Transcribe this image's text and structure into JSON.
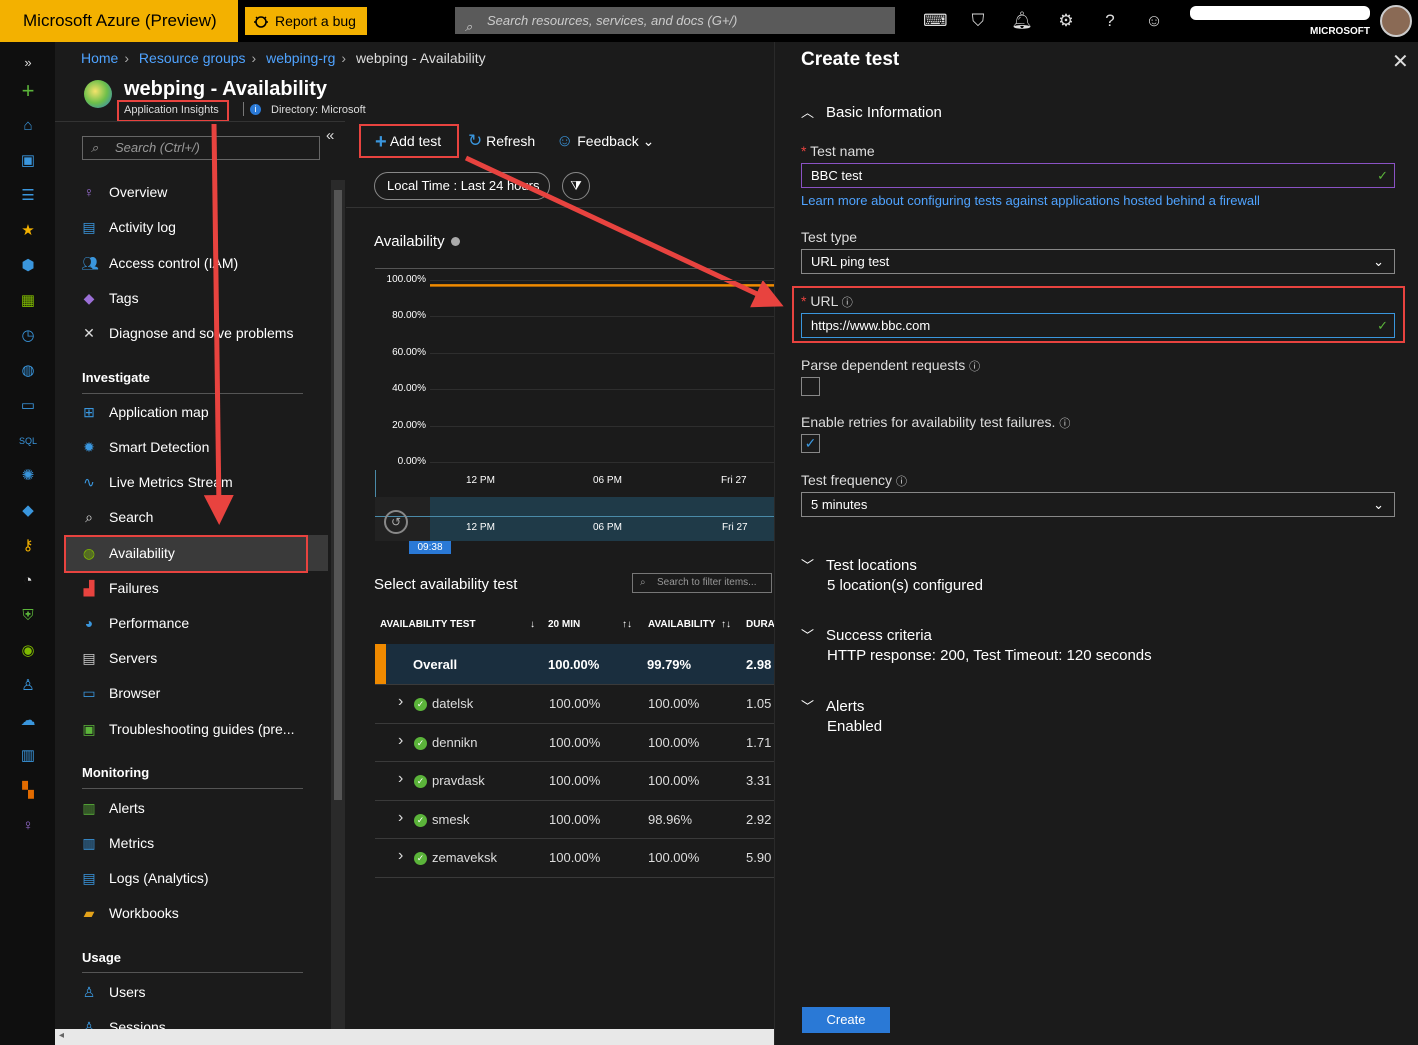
{
  "topbar": {
    "brand": "Microsoft Azure (Preview)",
    "bug_button": "Report a bug",
    "search_placeholder": "Search resources, services, and docs (G+/)",
    "tenant": "MICROSOFT"
  },
  "breadcrumb": {
    "home": "Home",
    "resource_groups": "Resource groups",
    "rg": "webping-rg",
    "current": "webping - Availability"
  },
  "header": {
    "title": "webping - Availability",
    "subtitle": "Application Insights",
    "directory": "Directory: Microsoft"
  },
  "leftnav": {
    "search_placeholder": "Search (Ctrl+/)",
    "items_top": [
      "Overview",
      "Activity log",
      "Access control (IAM)",
      "Tags",
      "Diagnose and solve problems"
    ],
    "investigate_label": "Investigate",
    "investigate": [
      "Application map",
      "Smart Detection",
      "Live Metrics Stream",
      "Search",
      "Availability",
      "Failures",
      "Performance",
      "Servers",
      "Browser",
      "Troubleshooting guides (pre..."
    ],
    "monitoring_label": "Monitoring",
    "monitoring": [
      "Alerts",
      "Metrics",
      "Logs (Analytics)",
      "Workbooks"
    ],
    "usage_label": "Usage",
    "usage": [
      "Users",
      "Sessions"
    ]
  },
  "toolbar": {
    "add_test": "Add test",
    "refresh": "Refresh",
    "feedback": "Feedback"
  },
  "time_range": "Local Time : Last 24 hours",
  "chart_data": {
    "type": "line",
    "title": "Availability",
    "y_ticks": [
      "100.00%",
      "80.00%",
      "60.00%",
      "40.00%",
      "20.00%",
      "0.00%"
    ],
    "x_ticks": [
      "12 PM",
      "06 PM",
      "Fri 27"
    ],
    "ylim": [
      0,
      100
    ],
    "series": [
      {
        "color": "#f08a00",
        "values": [
          99.79,
          99.79,
          99.79,
          99.79,
          99.79,
          99.79
        ]
      }
    ],
    "brush_time": "09:38"
  },
  "table": {
    "title": "Select availability test",
    "filter_placeholder": "Search to filter items...",
    "headers": [
      "AVAILABILITY TEST",
      "20 MIN",
      "AVAILABILITY",
      "DURA"
    ],
    "overall": {
      "name": "Overall",
      "min20": "100.00%",
      "availability": "99.79%",
      "duration": "2.98"
    },
    "rows": [
      {
        "name": "datelsk",
        "min20": "100.00%",
        "availability": "100.00%",
        "duration": "1.05"
      },
      {
        "name": "dennikn",
        "min20": "100.00%",
        "availability": "100.00%",
        "duration": "1.71"
      },
      {
        "name": "pravdask",
        "min20": "100.00%",
        "availability": "100.00%",
        "duration": "3.31"
      },
      {
        "name": "smesk",
        "min20": "100.00%",
        "availability": "98.96%",
        "duration": "2.92"
      },
      {
        "name": "zemaveksk",
        "min20": "100.00%",
        "availability": "100.00%",
        "duration": "5.90"
      }
    ]
  },
  "panel": {
    "title": "Create test",
    "basic_info": "Basic Information",
    "test_name_label": "Test name",
    "test_name_value": "BBC test",
    "firewall_link": "Learn more about configuring tests against applications hosted behind a firewall",
    "test_type_label": "Test type",
    "test_type_value": "URL ping test",
    "url_label": "URL",
    "url_value": "https://www.bbc.com",
    "parse_label": "Parse dependent requests",
    "parse_checked": false,
    "retries_label": "Enable retries for availability test failures.",
    "retries_checked": true,
    "freq_label": "Test frequency",
    "freq_value": "5 minutes",
    "locations_title": "Test locations",
    "locations_value": "5 location(s) configured",
    "criteria_title": "Success criteria",
    "criteria_value": "HTTP response: 200, Test Timeout: 120 seconds",
    "alerts_title": "Alerts",
    "alerts_value": "Enabled",
    "create_button": "Create"
  },
  "colors": {
    "accent": "#2a79d6",
    "brand": "#f3b100",
    "highlight": "#e8433f",
    "series": "#f08a00",
    "success": "#5bb43a"
  }
}
